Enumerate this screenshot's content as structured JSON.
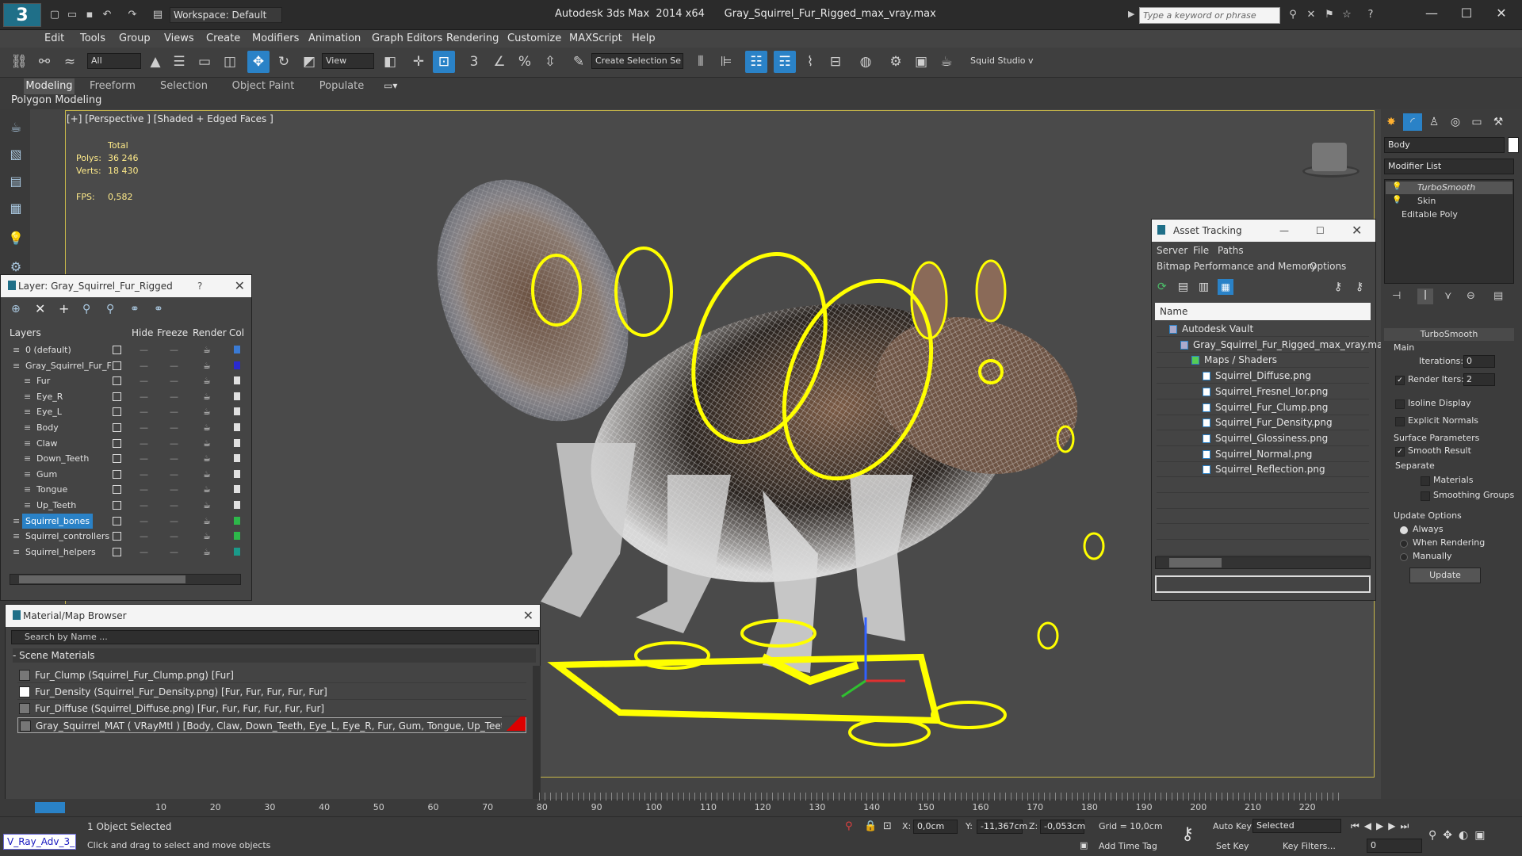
{
  "titlebar": {
    "workspace": "Workspace: Default",
    "title": "Autodesk 3ds Max  2014 x64      Gray_Squirrel_Fur_Rigged_max_vray.max",
    "search_placeholder": "Type a keyword or phrase"
  },
  "menu": [
    "Edit",
    "Tools",
    "Group",
    "Views",
    "Create",
    "Modifiers",
    "Animation",
    "Graph Editors",
    "Rendering",
    "Customize",
    "MAXScript",
    "Help"
  ],
  "toolbar": {
    "filter": "All",
    "coord": "View",
    "selection_set": "Create Selection Se",
    "studio": "Squid Studio v"
  },
  "ribbon": {
    "tabs": [
      "Modeling",
      "Freeform",
      "Selection",
      "Object Paint",
      "Populate"
    ],
    "panel_label": "Polygon Modeling"
  },
  "viewport": {
    "label": "[+] [Perspective ] [Shaded + Edged Faces ]",
    "stats_header": "Total",
    "polys_label": "Polys:",
    "polys": "36 246",
    "verts_label": "Verts:",
    "verts": "18 430",
    "fps_label": "FPS:",
    "fps": "0,582"
  },
  "layer_panel": {
    "title": "Layer: Gray_Squirrel_Fur_Rigged",
    "columns": [
      "Layers",
      "Hide",
      "Freeze",
      "Render",
      "Col"
    ],
    "rows": [
      {
        "name": "0 (default)",
        "indent": 0,
        "color": "#3a7bd5"
      },
      {
        "name": "Gray_Squirrel_Fur_F",
        "indent": 0,
        "color": "#2a2ad0"
      },
      {
        "name": "Fur",
        "indent": 1,
        "color": "#e0e0e0"
      },
      {
        "name": "Eye_R",
        "indent": 1,
        "color": "#e0e0e0"
      },
      {
        "name": "Eye_L",
        "indent": 1,
        "color": "#e0e0e0"
      },
      {
        "name": "Body",
        "indent": 1,
        "color": "#e0e0e0"
      },
      {
        "name": "Claw",
        "indent": 1,
        "color": "#e0e0e0"
      },
      {
        "name": "Down_Teeth",
        "indent": 1,
        "color": "#e0e0e0"
      },
      {
        "name": "Gum",
        "indent": 1,
        "color": "#e0e0e0"
      },
      {
        "name": "Tongue",
        "indent": 1,
        "color": "#e0e0e0"
      },
      {
        "name": "Up_Teeth",
        "indent": 1,
        "color": "#e0e0e0"
      },
      {
        "name": "Squirrel_bones",
        "indent": 0,
        "color": "#2db84a",
        "selected": true
      },
      {
        "name": "Squirrel_controllers",
        "indent": 0,
        "color": "#2db84a"
      },
      {
        "name": "Squirrel_helpers",
        "indent": 0,
        "color": "#1a9a8a"
      }
    ]
  },
  "material_browser": {
    "title": "Material/Map Browser",
    "search_placeholder": "Search by Name ...",
    "section": "- Scene Materials",
    "rows": [
      "Fur_Clump (Squirrel_Fur_Clump.png) [Fur]",
      "Fur_Density (Squirrel_Fur_Density.png) [Fur, Fur, Fur, Fur, Fur]",
      "Fur_Diffuse (Squirrel_Diffuse.png) [Fur, Fur, Fur, Fur, Fur, Fur]",
      "Gray_Squirrel_MAT ( VRayMtl ) [Body, Claw, Down_Teeth, Eye_L, Eye_R, Fur, Gum, Tongue, Up_Teeth]"
    ]
  },
  "asset_tracking": {
    "title": "Asset Tracking",
    "menu1": [
      "Server",
      "File",
      "Paths"
    ],
    "menu2": [
      "Bitmap Performance and Memory",
      "Options"
    ],
    "column": "Name",
    "rows": [
      {
        "name": "Autodesk Vault",
        "indent": 1
      },
      {
        "name": "Gray_Squirrel_Fur_Rigged_max_vray.max",
        "indent": 2
      },
      {
        "name": "Maps / Shaders",
        "indent": 3
      },
      {
        "name": "Squirrel_Diffuse.png",
        "indent": 4
      },
      {
        "name": "Squirrel_Fresnel_Ior.png",
        "indent": 4
      },
      {
        "name": "Squirrel_Fur_Clump.png",
        "indent": 4
      },
      {
        "name": "Squirrel_Fur_Density.png",
        "indent": 4
      },
      {
        "name": "Squirrel_Glossiness.png",
        "indent": 4
      },
      {
        "name": "Squirrel_Normal.png",
        "indent": 4
      },
      {
        "name": "Squirrel_Reflection.png",
        "indent": 4
      }
    ]
  },
  "command_panel": {
    "object_name": "Body",
    "modifier_list": "Modifier List",
    "stack": [
      "TurboSmooth",
      "Skin",
      "Editable Poly"
    ],
    "rollout_title": "TurboSmooth",
    "main": "Main",
    "iterations_label": "Iterations:",
    "iterations": "0",
    "render_iters_label": "Render Iters:",
    "render_iters": "2",
    "isoline": "Isoline Display",
    "explicit": "Explicit Normals",
    "surface": "Surface Parameters",
    "smooth_result": "Smooth Result",
    "separate": "Separate",
    "materials": "Materials",
    "smoothing_groups": "Smoothing Groups",
    "update_options": "Update Options",
    "always": "Always",
    "when_rendering": "When Rendering",
    "manually": "Manually",
    "update_btn": "Update"
  },
  "timeline": {
    "ticks": [
      "10",
      "20",
      "30",
      "40",
      "50",
      "60",
      "70",
      "80",
      "90",
      "100",
      "110",
      "120",
      "130",
      "140",
      "150",
      "160",
      "170",
      "180",
      "190",
      "200",
      "210",
      "220"
    ]
  },
  "status": {
    "script": "V_Ray_Adv_3_",
    "selected": "1 Object Selected",
    "prompt": "Click and drag to select and move objects",
    "x_label": "X:",
    "x": "0,0cm",
    "y_label": "Y:",
    "y": "-11,367cm",
    "z_label": "Z:",
    "z": "-0,053cm",
    "grid": "Grid = 10,0cm",
    "add_time_tag": "Add Time Tag",
    "auto_key": "Auto Key",
    "set_key": "Set Key",
    "selected_drop": "Selected",
    "key_filters": "Key Filters...",
    "frame": "0"
  }
}
